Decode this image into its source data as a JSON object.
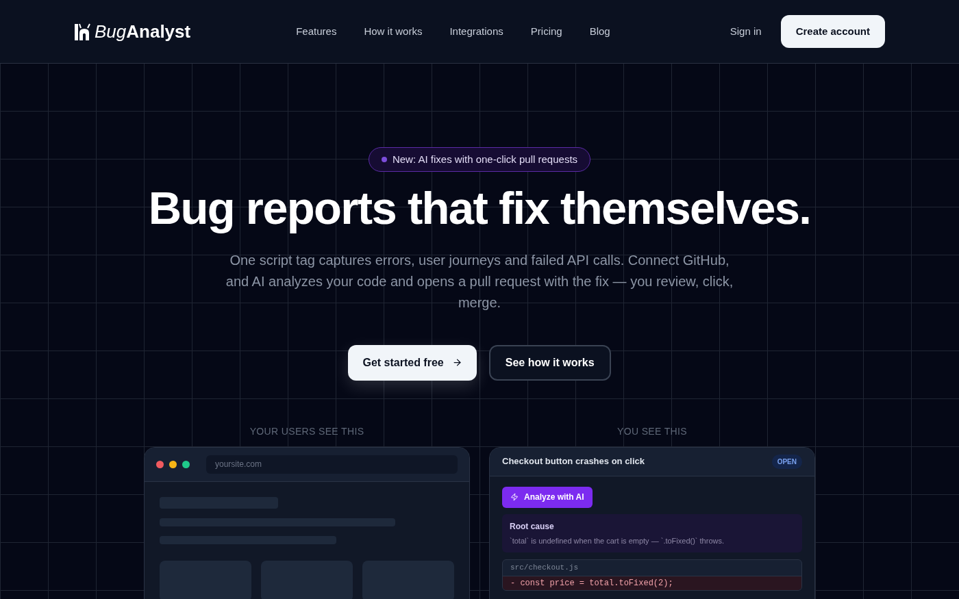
{
  "brand": {
    "light": "Bug",
    "bold": "Analyst"
  },
  "nav": {
    "links": [
      "Features",
      "How it works",
      "Integrations",
      "Pricing",
      "Blog"
    ],
    "sign_in": "Sign in",
    "create_account": "Create account"
  },
  "hero": {
    "badge": "New: AI fixes with one-click pull requests",
    "title": "Bug reports that fix themselves.",
    "subtitle": "One script tag captures errors, user journeys and failed API calls. Connect GitHub, and AI analyzes your code and opens a pull request with the fix — you review, click, merge.",
    "primary_button": "Get started free",
    "secondary_button": "See how it works"
  },
  "users_panel": {
    "label": "YOUR USERS SEE THIS",
    "address": "yoursite.com"
  },
  "you_panel": {
    "label": "YOU SEE THIS",
    "issue_title": "Checkout button crashes on click",
    "status": "OPEN",
    "analyze_button": "Analyze with AI",
    "root_cause_title": "Root cause",
    "root_cause_text": "`total` is undefined when the cart is empty — `.toFixed()` throws.",
    "file": "src/checkout.js",
    "diff_lines": [
      {
        "kind": "removed",
        "text": "- const price = total.toFixed(2);"
      }
    ]
  }
}
